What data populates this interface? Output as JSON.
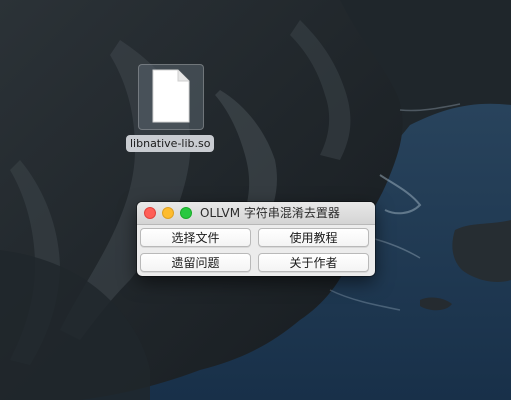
{
  "desktop": {
    "file": {
      "name": "libnative-lib.so",
      "icon": "blank-document-icon"
    }
  },
  "window": {
    "title": "OLLVM 字符串混淆去置器",
    "controls": {
      "close_color": "#ff5f57",
      "minimize_color": "#febc2e",
      "zoom_color": "#28c840"
    },
    "buttons": {
      "select_file": "选择文件",
      "usage_guide": "使用教程",
      "known_issues": "遗留问题",
      "about_author": "关于作者"
    }
  }
}
